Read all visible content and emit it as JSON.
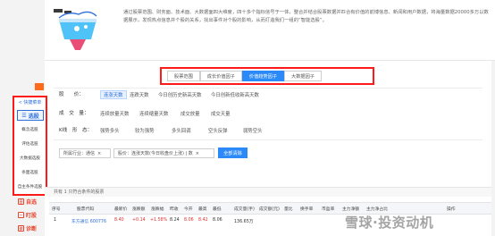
{
  "intro": {
    "text": "通过股票范围、财务面、技术面、大数据面四大维度，四十多个指标信号于一体，整合并结合股票数据并匹合有价值的前博信息、新闻和用户数据，将海量数据20000多万以数据展示，发现热点信息并个股的关系，找出事件对个股的影响，从而打造我们一组的“智能选股”。"
  },
  "sidebar": {
    "title": "< 快捷菜单",
    "main_label": "选股",
    "items": [
      "概念选股",
      "评估选股",
      "大数据选股",
      "条面选股",
      "自主条件选股"
    ],
    "below": [
      {
        "icon": "calendar-icon",
        "glyph": "日",
        "label": "自选"
      },
      {
        "icon": "trend-icon",
        "glyph": "~",
        "label": "盯股"
      },
      {
        "icon": "diagnose-icon",
        "glyph": "诊",
        "label": "诊断"
      }
    ]
  },
  "tabs": [
    {
      "label": "股票范围",
      "active": false
    },
    {
      "label": "成长价值因子",
      "active": false
    },
    {
      "label": "价值趋势因子",
      "active": true
    },
    {
      "label": "大数据因子",
      "active": false
    }
  ],
  "filters": [
    {
      "label": "股　　价：",
      "options": [
        "连涨天数",
        "连跌天数",
        "今日创历史新高天数",
        "今日创新低收新高天数"
      ]
    },
    {
      "label": "成　交　量：",
      "options": [
        "连续放量天数",
        "连续缩量天数",
        "成交放量",
        "成交天量"
      ]
    },
    {
      "label": "K线　形　态：",
      "options": [
        "强势多头",
        "较为强势",
        "多头回调",
        "空头反弹",
        "弱势空头"
      ]
    }
  ],
  "selects": [
    {
      "value": "所属行业：通信",
      "close": "×"
    },
    {
      "value": "股价：连涨天数(今日收盘价上涨) | 数",
      "close": "×"
    }
  ],
  "button_all": "全部清除",
  "result": "共有 1 只符合条件的股票",
  "table": {
    "headers": [
      "序号",
      "股票代码",
      "最新价",
      "涨跌额",
      "涨跌幅",
      "昨收",
      "今开",
      "最高",
      "最低",
      "成交量(手)",
      "成交额(元)",
      "量比",
      "换手率",
      "市盈率",
      "主力净额",
      "主力净占比",
      "操作"
    ],
    "row": [
      "1",
      "东方通信 600776",
      "8.40",
      "+0.14",
      "+1.58%",
      "8.24",
      "8.06",
      "8.42",
      "8.06",
      "136.65万",
      "",
      "",
      "",
      "",
      "",
      "",
      ""
    ]
  },
  "watermark": "雪球·投资动机"
}
